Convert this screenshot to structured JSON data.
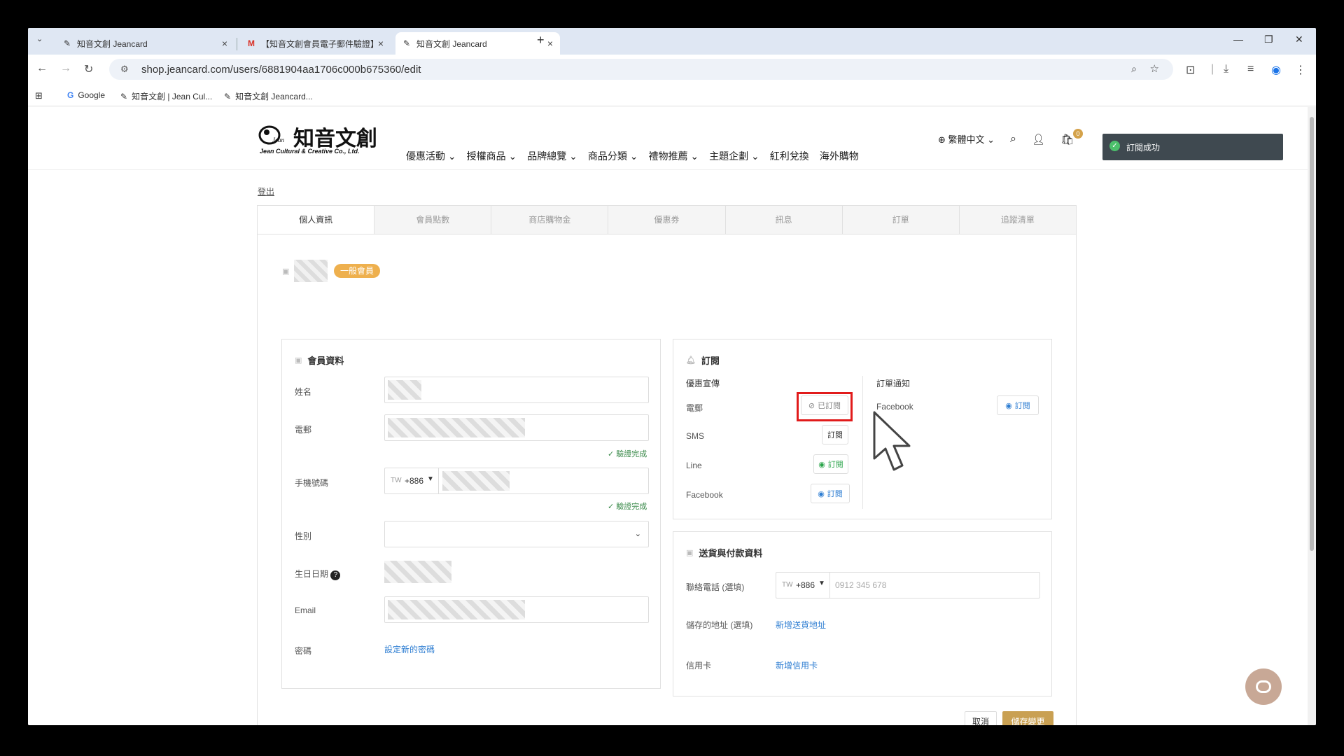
{
  "browser": {
    "tabs": [
      {
        "title": "知音文創 Jeancard",
        "close": "×"
      },
      {
        "title": "【知音文創會員電子郵件驗證】",
        "close": "×"
      },
      {
        "title": "知音文創 Jeancard",
        "close": "×"
      }
    ],
    "new_tab": "+",
    "url": "shop.jeancard.com/users/6881904aa1706c000b675360/edit",
    "bookmarks": [
      "Google",
      "知音文創 | Jean Cul...",
      "知音文創 Jeancard..."
    ]
  },
  "site": {
    "logo_main": "知音文創",
    "logo_sub": "Jean Cultural & Creative Co., Ltd.",
    "nav": [
      "優惠活動 ⌄",
      "授權商品 ⌄",
      "品牌總覽 ⌄",
      "商品分類 ⌄",
      "禮物推薦 ⌄",
      "主題企劃 ⌄",
      "紅利兌換",
      "海外購物"
    ],
    "language": "繁體中文 ⌄",
    "cart_count": "0"
  },
  "toast": {
    "message": "訂閱成功"
  },
  "account": {
    "logout": "登出",
    "tabs": [
      "個人資訊",
      "會員點數",
      "商店購物金",
      "優惠券",
      "訊息",
      "訂單",
      "追蹤清單"
    ],
    "member_level": "一般會員"
  },
  "member_info": {
    "title": "會員資料",
    "name_label": "姓名",
    "email_label": "電郵",
    "verified": "驗證完成",
    "phone_label": "手機號碼",
    "phone_country": "TW",
    "phone_code": "+886",
    "gender_label": "性別",
    "birthday_label": "生日日期",
    "email2_label": "Email",
    "password_label": "密碼",
    "password_link": "設定新的密碼"
  },
  "subscription": {
    "title": "訂閱",
    "promo_title": "優惠宣傳",
    "order_title": "訂單通知",
    "rows": [
      {
        "label": "電郵",
        "button": "已訂閱"
      },
      {
        "label": "SMS",
        "button": "訂閱"
      },
      {
        "label": "Line",
        "button": "訂閱"
      },
      {
        "label": "Facebook",
        "button": "訂閱"
      }
    ],
    "order_rows": [
      {
        "label": "Facebook",
        "button": "訂閱"
      }
    ]
  },
  "delivery": {
    "title": "送貨與付款資料",
    "phone_label": "聯絡電話 (選填)",
    "phone_country": "TW",
    "phone_code": "+886",
    "phone_placeholder": "0912 345 678",
    "address_label": "儲存的地址 (選填)",
    "address_link": "新增送貨地址",
    "card_label": "信用卡",
    "card_link": "新增信用卡"
  },
  "actions": {
    "cancel": "取消",
    "save": "儲存變更"
  }
}
